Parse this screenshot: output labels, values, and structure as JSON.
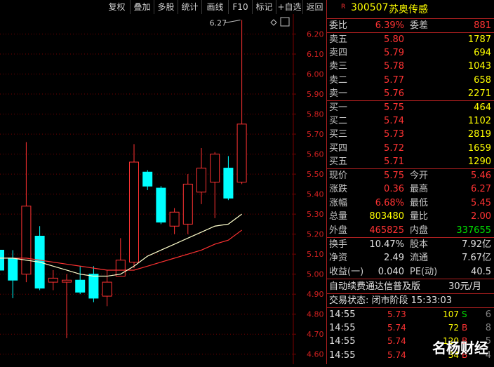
{
  "toolbar": {
    "buttons": [
      "复权",
      "叠加",
      "多股",
      "统计",
      "画线",
      "F10",
      "标记",
      "+自选",
      "返回"
    ]
  },
  "chart": {
    "y_ticks": [
      "6.20",
      "6.10",
      "6.00",
      "5.90",
      "5.80",
      "5.70",
      "5.60",
      "5.50",
      "5.40",
      "5.30",
      "5.20",
      "5.10",
      "5.00",
      "4.90",
      "4.80",
      "4.70",
      "4.60"
    ],
    "high_marker": "6.27",
    "colors": {
      "up": "#ff3232",
      "down": "#00ffff",
      "ma_short": "#ffffcc",
      "ma_long": "#ff3232",
      "grid": "#7a0000"
    }
  },
  "chart_data": {
    "type": "candlestick",
    "ylim": [
      4.55,
      6.3
    ],
    "candles": [
      {
        "o": 5.12,
        "c": 5.02,
        "h": 5.16,
        "l": 4.96
      },
      {
        "o": 5.08,
        "c": 4.97,
        "h": 5.12,
        "l": 4.88
      },
      {
        "o": 5.0,
        "c": 5.34,
        "h": 5.66,
        "l": 4.96
      },
      {
        "o": 5.19,
        "c": 4.93,
        "h": 5.24,
        "l": 4.92
      },
      {
        "o": 4.96,
        "c": 4.98,
        "h": 5.02,
        "l": 4.92
      },
      {
        "o": 4.96,
        "c": 4.97,
        "h": 5.0,
        "l": 4.68
      },
      {
        "o": 4.97,
        "c": 4.91,
        "h": 5.04,
        "l": 4.9
      },
      {
        "o": 5.0,
        "c": 4.88,
        "h": 5.04,
        "l": 4.86
      },
      {
        "o": 4.89,
        "c": 4.96,
        "h": 5.02,
        "l": 4.84
      },
      {
        "o": 4.99,
        "c": 5.07,
        "h": 5.18,
        "l": 4.99
      },
      {
        "o": 5.06,
        "c": 5.56,
        "h": 5.65,
        "l": 5.03
      },
      {
        "o": 5.51,
        "c": 5.44,
        "h": 5.52,
        "l": 5.42
      },
      {
        "o": 5.43,
        "c": 5.26,
        "h": 5.44,
        "l": 5.25
      },
      {
        "o": 5.24,
        "c": 5.31,
        "h": 5.33,
        "l": 5.2
      },
      {
        "o": 5.25,
        "c": 5.45,
        "h": 5.5,
        "l": 5.2
      },
      {
        "o": 5.41,
        "c": 5.53,
        "h": 5.63,
        "l": 5.35
      },
      {
        "o": 5.46,
        "c": 5.6,
        "h": 5.61,
        "l": 5.28
      },
      {
        "o": 5.53,
        "c": 5.38,
        "h": 5.59,
        "l": 5.37
      },
      {
        "o": 5.46,
        "c": 5.75,
        "h": 6.27,
        "l": 5.45
      }
    ],
    "ma_short": [
      5.08,
      5.08,
      5.07,
      5.06,
      5.04,
      5.02,
      5.0,
      4.99,
      4.99,
      5.0,
      5.04,
      5.09,
      5.12,
      5.15,
      5.18,
      5.21,
      5.24,
      5.25,
      5.3
    ],
    "ma_long": [
      5.08,
      5.08,
      5.08,
      5.07,
      5.06,
      5.05,
      5.04,
      5.03,
      5.02,
      5.02,
      5.02,
      5.04,
      5.06,
      5.08,
      5.1,
      5.12,
      5.15,
      5.17,
      5.22
    ]
  },
  "quote": {
    "badge": "R",
    "code": "300507",
    "name": "苏奥传感",
    "wb": {
      "label": "委比",
      "value": "6.39%",
      "label2": "委差",
      "value2": "881"
    },
    "asks": [
      {
        "label": "卖五",
        "price": "5.80",
        "vol": "1787"
      },
      {
        "label": "卖四",
        "price": "5.79",
        "vol": "694"
      },
      {
        "label": "卖三",
        "price": "5.78",
        "vol": "1043"
      },
      {
        "label": "卖二",
        "price": "5.77",
        "vol": "658"
      },
      {
        "label": "卖一",
        "price": "5.76",
        "vol": "2271"
      }
    ],
    "bids": [
      {
        "label": "买一",
        "price": "5.75",
        "vol": "464"
      },
      {
        "label": "买二",
        "price": "5.74",
        "vol": "1102"
      },
      {
        "label": "买三",
        "price": "5.73",
        "vol": "2819"
      },
      {
        "label": "买四",
        "price": "5.72",
        "vol": "1659"
      },
      {
        "label": "买五",
        "price": "5.71",
        "vol": "1290"
      }
    ],
    "stats": [
      {
        "l1": "现价",
        "v1": "5.75",
        "l2": "今开",
        "v2": "5.46"
      },
      {
        "l1": "涨跌",
        "v1": "0.36",
        "l2": "最高",
        "v2": "6.27"
      },
      {
        "l1": "涨幅",
        "v1": "6.68%",
        "l2": "最低",
        "v2": "5.45"
      },
      {
        "l1": "总量",
        "v1": "803480",
        "l2": "量比",
        "v2": "2.00"
      },
      {
        "l1": "外盘",
        "v1": "465825",
        "l2": "内盘",
        "v2": "337655"
      }
    ],
    "fund": [
      {
        "l1": "换手",
        "v1": "10.47%",
        "l2": "股本",
        "v2": "7.92亿"
      },
      {
        "l1": "净资",
        "v1": "2.49",
        "l2": "流通",
        "v2": "7.67亿"
      },
      {
        "l1": "收益(一)",
        "v1": "0.040",
        "l2": "PE(动)",
        "v2": "40.5"
      }
    ],
    "promo": "自动续费通达信普及版",
    "promo_price": "30元/月",
    "status": "交易状态: 闭市阶段 15:33:03",
    "ticks": [
      {
        "time": "14:55",
        "price": "5.73",
        "vol": "107",
        "side": "S",
        "n": "6"
      },
      {
        "time": "14:55",
        "price": "5.74",
        "vol": "72",
        "side": "B",
        "n": "8"
      },
      {
        "time": "14:55",
        "price": "5.74",
        "vol": "120",
        "side": "B",
        "n": "5"
      },
      {
        "time": "14:55",
        "price": "5.74",
        "vol": "34",
        "side": "B",
        "n": "4"
      }
    ]
  },
  "watermark": "名杨财经"
}
